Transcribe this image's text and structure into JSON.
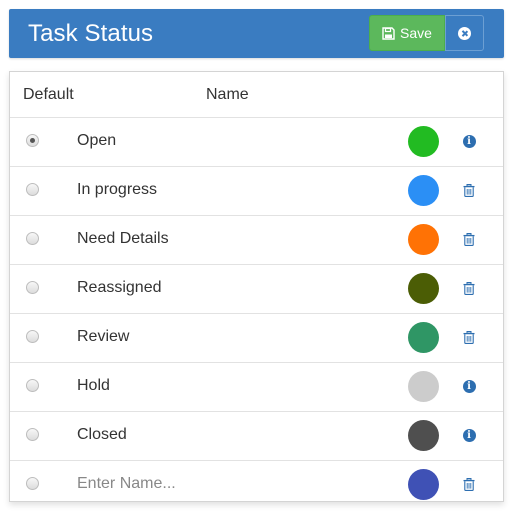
{
  "header": {
    "title": "Task Status",
    "save_label": "Save"
  },
  "table": {
    "columns": [
      "Default",
      "Name"
    ],
    "rows": [
      {
        "name": "Open",
        "color": "#22bb22",
        "default": true,
        "action": "info-icon"
      },
      {
        "name": "In progress",
        "color": "#2b8ff5",
        "default": false,
        "action": "trash-icon"
      },
      {
        "name": "Need Details",
        "color": "#ff7205",
        "default": false,
        "action": "trash-icon"
      },
      {
        "name": "Reassigned",
        "color": "#4b5d05",
        "default": false,
        "action": "trash-icon"
      },
      {
        "name": "Review",
        "color": "#2f9665",
        "default": false,
        "action": "trash-icon"
      },
      {
        "name": "Hold",
        "color": "#cccccc",
        "default": false,
        "action": "info-icon"
      },
      {
        "name": "Closed",
        "color": "#4f4f4f",
        "default": false,
        "action": "info-icon"
      }
    ],
    "new_row": {
      "placeholder": "Enter Name...",
      "value": "",
      "color": "#3f51b5",
      "action": "trash-icon"
    }
  },
  "colors": {
    "header_bg": "#3a7cc1",
    "save_bg": "#5cb85c",
    "icon": "#2d6eb0"
  }
}
